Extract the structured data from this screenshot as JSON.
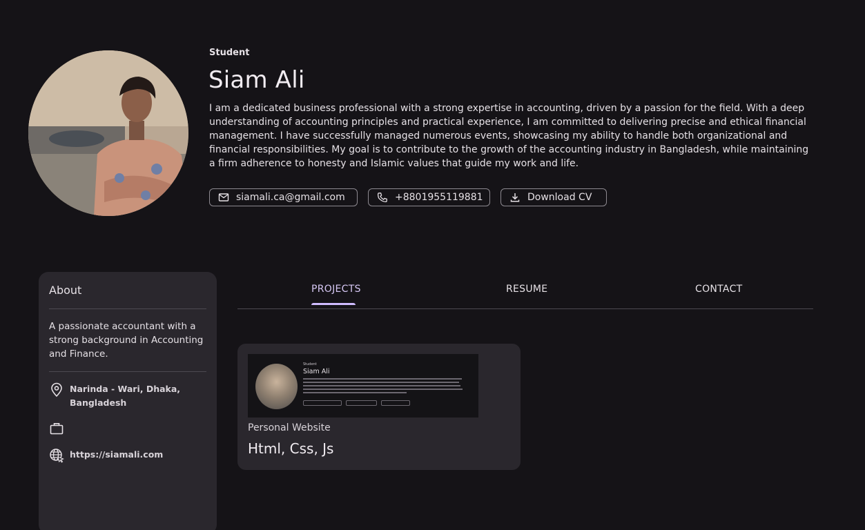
{
  "profile": {
    "role": "Student",
    "name": "Siam Ali",
    "bio": "I am a dedicated business professional with a strong expertise in accounting, driven by a passion for the field. With a deep understanding of accounting principles and practical experience, I am committed to delivering precise and ethical financial management. I have successfully managed numerous events, showcasing my ability to handle both organizational and financial responsibilities. My goal is to contribute to the growth of the accounting industry in Bangladesh, while maintaining a firm adherence to honesty and Islamic values that guide my work and life."
  },
  "actions": {
    "email": "siamali.ca@gmail.com",
    "phone": "+8801955119881",
    "download": "Download CV"
  },
  "about": {
    "title": "About",
    "description": "A passionate accountant with a strong background in Accounting and Finance.",
    "location": "Narinda - Wari, Dhaka, Bangladesh",
    "website": "https://siamali.com"
  },
  "tabs": [
    "PROJECTS",
    "RESUME",
    "CONTACT"
  ],
  "projects": [
    {
      "title": "Personal Website",
      "tech": "Html, Css, Js",
      "thumbnail": {
        "role": "Student",
        "name": "Siam Ali"
      }
    }
  ],
  "colors": {
    "background": "#151317",
    "surface": "#2a272d",
    "accent": "#d0bcff"
  }
}
